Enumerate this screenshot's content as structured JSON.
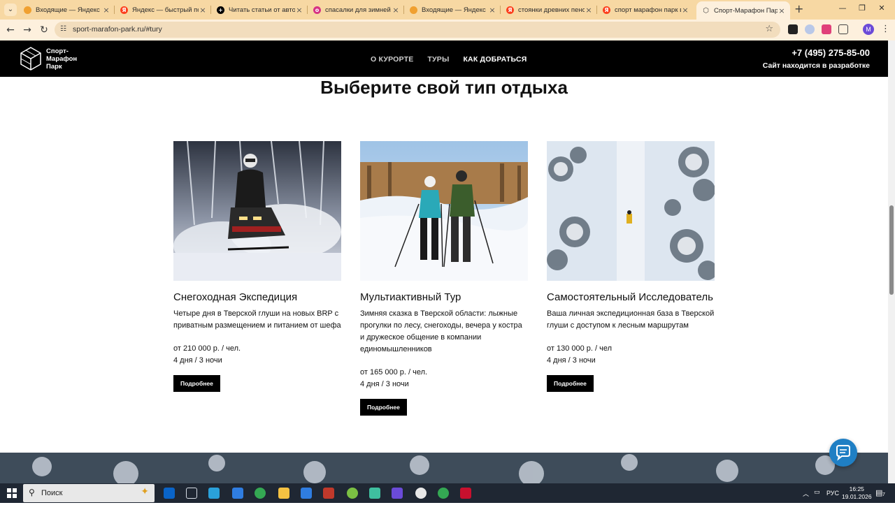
{
  "browser": {
    "tabs": [
      {
        "title": "Входящие — Яндекс Поч",
        "favicon": "yandex-mail-icon",
        "color": "#f0a030"
      },
      {
        "title": "Яндекс — быстрый пои",
        "favicon": "yandex-icon",
        "color": "#fc3f1d"
      },
      {
        "title": "Читать статьи от автор",
        "favicon": "dzen-icon",
        "color": "#000000"
      },
      {
        "title": "спасалки для зимней ры",
        "favicon": "ozon-icon",
        "color": "#d63384"
      },
      {
        "title": "Входящие — Яндекс По",
        "favicon": "yandex-mail-icon",
        "color": "#f0a030"
      },
      {
        "title": "стоянки древних пенос",
        "favicon": "yandex-icon",
        "color": "#fc3f1d"
      },
      {
        "title": "спорт марафон парк все",
        "favicon": "yandex-icon",
        "color": "#fc3f1d"
      },
      {
        "title": "Спорт-Марафон Парк",
        "favicon": "site-cube-icon",
        "color": "#555555",
        "active": true
      }
    ],
    "url": "sport-marafon-park.ru/#tury"
  },
  "site": {
    "logo_lines": [
      "Спорт-",
      "Марафон",
      "Парк"
    ],
    "nav": [
      "О КУРОРТЕ",
      "ТУРЫ",
      "КАК ДОБРАТЬСЯ"
    ],
    "phone": "+7 (495) 275-85-00",
    "dev_note": "Сайт находится в разработке"
  },
  "section": {
    "title": "Выберите свой тип отдыха",
    "cards": [
      {
        "name": "Снегоходная Экспедиция",
        "description": "Четыре дня в Тверской глуши на новых BRP с приватным размещением и питанием от шефа",
        "price": "от 210 000 р. / чел.",
        "duration": "4 дня / 3 ночи",
        "button": "Подробнее"
      },
      {
        "name": "Мультиактивный Тур",
        "description": "Зимняя сказка в Тверской области: лыжные прогулки по лесу, снегоходы, вечера у костра и дружеское общение в компании единомышленников",
        "price": "от 165 000 р. / чел.",
        "duration": "4 дня / 3 ночи",
        "button": "Подробнее"
      },
      {
        "name": "Самостоятельный Исследователь",
        "description": "Ваша личная экспедиционная база в Тверской глуши с доступом к лесным маршрутам",
        "price": "от 130 000 р. / чел",
        "duration": "4 дня / 3 ночи",
        "button": "Подробнее"
      }
    ]
  },
  "taskbar": {
    "search_placeholder": "Поиск",
    "lang": "РУС",
    "time": "16:25",
    "date": "19.01.2026",
    "notification_count": "7"
  }
}
